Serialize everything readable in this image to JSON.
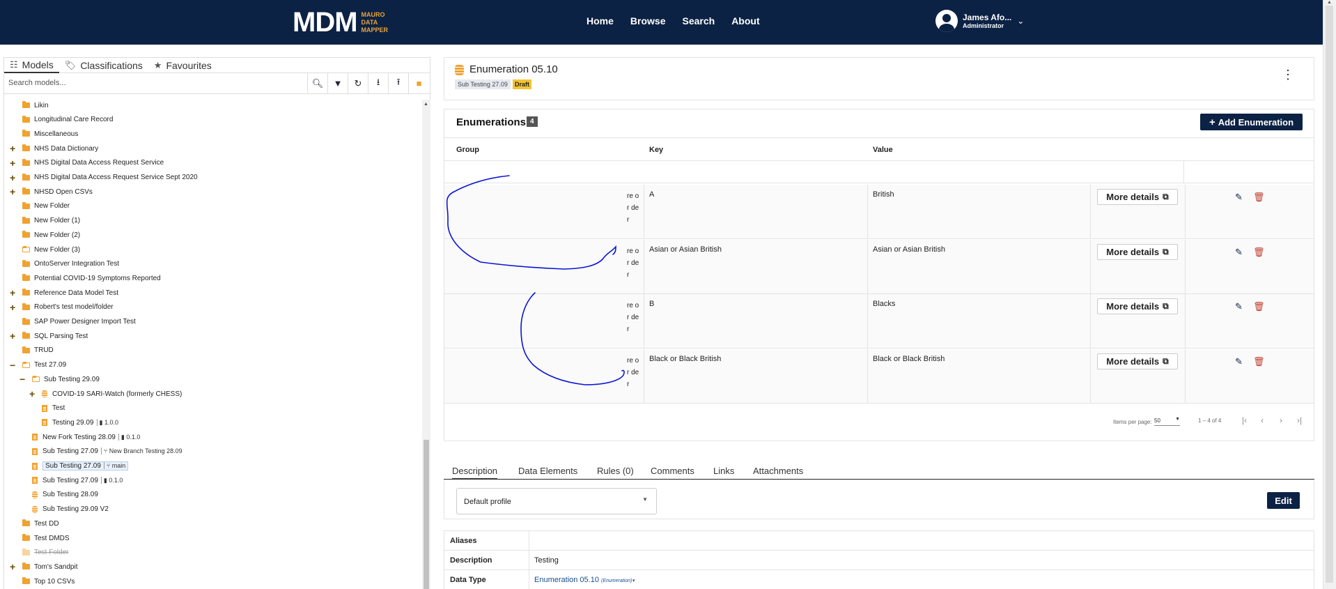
{
  "header": {
    "logo_main": "MDM",
    "logo_sub_1": "MAURO",
    "logo_sub_2": "DATA",
    "logo_sub_3": "MAPPER",
    "nav": [
      "Home",
      "Browse",
      "Search",
      "About"
    ],
    "user_name": "James Afo...",
    "user_role": "Administrator",
    "bg_color": "#0c2244"
  },
  "left": {
    "tabs": [
      "Models",
      "Classifications",
      "Favourites"
    ],
    "search_placeholder": "Search models...",
    "tree": [
      {
        "label": "Likin",
        "expand": "",
        "icon": "folder",
        "ver": ""
      },
      {
        "label": "Longitudinal Care Record",
        "expand": "",
        "icon": "folder",
        "ver": ""
      },
      {
        "label": "Miscellaneous",
        "expand": "",
        "icon": "folder",
        "ver": ""
      },
      {
        "label": "NHS Data Dictionary",
        "expand": "+",
        "icon": "folder",
        "ver": ""
      },
      {
        "label": "NHS Digital Data Access Request Service",
        "expand": "+",
        "icon": "folder",
        "ver": ""
      },
      {
        "label": "NHS Digital Data Access Request Service Sept 2020",
        "expand": "+",
        "icon": "folder",
        "ver": ""
      },
      {
        "label": "NHSD Open CSVs",
        "expand": "+",
        "icon": "folder",
        "ver": ""
      },
      {
        "label": "New Folder",
        "expand": "",
        "icon": "folder",
        "ver": ""
      },
      {
        "label": "New Folder (1)",
        "expand": "",
        "icon": "folder",
        "ver": ""
      },
      {
        "label": "New Folder (2)",
        "expand": "",
        "icon": "folder",
        "ver": ""
      },
      {
        "label": "New Folder (3)",
        "expand": "",
        "icon": "folder-open",
        "ver": ""
      },
      {
        "label": "OntoServer Integration Test",
        "expand": "",
        "icon": "folder",
        "ver": ""
      },
      {
        "label": "Potential COVID-19 Symptoms Reported",
        "expand": "",
        "icon": "folder",
        "ver": ""
      },
      {
        "label": "Reference Data Model Test",
        "expand": "+",
        "icon": "folder",
        "ver": ""
      },
      {
        "label": "Robert's test model/folder",
        "expand": "+",
        "icon": "folder",
        "ver": ""
      },
      {
        "label": "SAP Power Designer Import Test",
        "expand": "",
        "icon": "folder",
        "ver": ""
      },
      {
        "label": "SQL Parsing Test",
        "expand": "+",
        "icon": "folder",
        "ver": ""
      },
      {
        "label": "TRUD",
        "expand": "",
        "icon": "folder",
        "ver": ""
      },
      {
        "label": "Test 27.09",
        "expand": "−",
        "icon": "folder-open",
        "ver": ""
      },
      {
        "label": "Sub Testing 29.09",
        "expand": "−",
        "icon": "folder-open",
        "ver": "",
        "indent": 1
      },
      {
        "label": "COVID-19 SARI-Watch (formerly CHESS)",
        "expand": "+",
        "icon": "db",
        "ver": "",
        "indent": 2
      },
      {
        "label": "Test",
        "expand": "",
        "icon": "doc",
        "ver": "",
        "indent": 2
      },
      {
        "label": "Testing 29.09",
        "expand": "",
        "icon": "doc",
        "ver": "▮ 1.0.0",
        "indent": 2
      },
      {
        "label": "New Fork Testing 28.09",
        "expand": "",
        "icon": "doc",
        "ver": "▮ 0.1.0",
        "indent": 1
      },
      {
        "label": "Sub Testing 27.09",
        "expand": "",
        "icon": "doc",
        "ver": "⑂ New Branch Testing 28.09",
        "indent": 1
      },
      {
        "label": "Sub Testing 27.09",
        "expand": "",
        "icon": "doc",
        "ver": "⑂ main",
        "indent": 1,
        "selected": true
      },
      {
        "label": "Sub Testing 27.09",
        "expand": "",
        "icon": "doc",
        "ver": "▮ 0.1.0",
        "indent": 1
      },
      {
        "label": "Sub Testing 28.09",
        "expand": "",
        "icon": "db",
        "ver": "",
        "indent": 1
      },
      {
        "label": "Sub Testing 29.09 V2",
        "expand": "",
        "icon": "db",
        "ver": "",
        "indent": 1
      },
      {
        "label": "Test DD",
        "expand": "",
        "icon": "folder",
        "ver": ""
      },
      {
        "label": "Test DMDS",
        "expand": "",
        "icon": "folder",
        "ver": ""
      },
      {
        "label": "Test Folder",
        "expand": "",
        "icon": "folder-faded",
        "ver": "",
        "strike": true
      },
      {
        "label": "Tom's Sandpit",
        "expand": "+",
        "icon": "folder",
        "ver": ""
      },
      {
        "label": "Top 10 CSVs",
        "expand": "",
        "icon": "folder",
        "ver": ""
      }
    ]
  },
  "model": {
    "title": "Enumeration 05.10",
    "parent_badge": "Sub Testing 27.09",
    "status_badge": "Draft"
  },
  "enumerations": {
    "title": "Enumerations",
    "count": "4",
    "add_label": "Add Enumeration",
    "columns": [
      "Group",
      "Key",
      "Value"
    ],
    "reorder_label": "re or de r",
    "more_label": "More details",
    "rows": [
      {
        "key": "A",
        "value": "British"
      },
      {
        "key": "Asian or Asian British",
        "value": "Asian or Asian British"
      },
      {
        "key": "B",
        "value": "Blacks"
      },
      {
        "key": "Black or Black British",
        "value": "Black or Black British"
      }
    ],
    "paginator": {
      "items_label": "Items per page:",
      "page_size": "50",
      "range": "1 – 4 of 4"
    }
  },
  "detail": {
    "tabs": [
      "Description",
      "Data Elements",
      "Rules (0)",
      "Comments",
      "Links",
      "Attachments"
    ],
    "profile": "Default profile",
    "edit_label": "Edit",
    "props": [
      {
        "key": "Aliases",
        "value": ""
      },
      {
        "key": "Description",
        "value": "Testing"
      },
      {
        "key": "Data Type",
        "value": "Enumeration 05.10",
        "sub": "(Enumeration)"
      }
    ]
  },
  "ink_color": "#0a14d6"
}
